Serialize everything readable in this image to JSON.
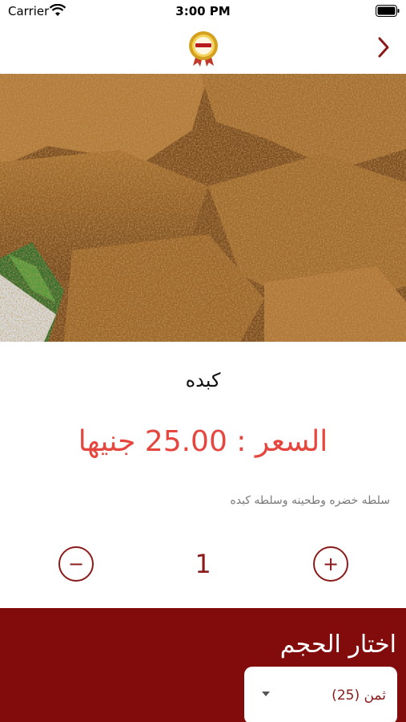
{
  "status": {
    "carrier": "Carrier",
    "time": "3:00 PM"
  },
  "product": {
    "name": "كبده",
    "price_text": "السعر :  25.00 جنيها",
    "description": "سلطه خضره وطحينه وسلطه كبده"
  },
  "quantity": {
    "value": "1",
    "minus_label": "−",
    "plus_label": "+"
  },
  "size": {
    "title": "اختار الحجم",
    "selected_option": "ثمن     (25)"
  },
  "colors": {
    "brand": "#820c0c",
    "price": "#e5463e",
    "accent": "#8b1a1a"
  },
  "icons": {
    "back": "chevron-right-icon",
    "logo": "restaurant-logo"
  }
}
